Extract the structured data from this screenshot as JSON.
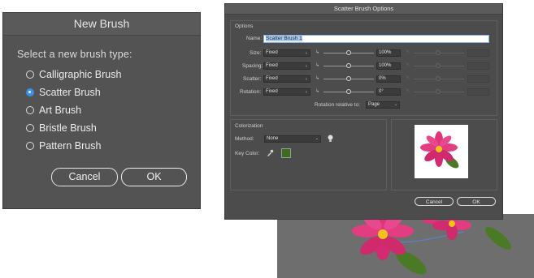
{
  "new_brush": {
    "title": "New Brush",
    "prompt": "Select a new brush type:",
    "options": [
      {
        "label": "Calligraphic Brush",
        "selected": false
      },
      {
        "label": "Scatter Brush",
        "selected": true
      },
      {
        "label": "Art Brush",
        "selected": false
      },
      {
        "label": "Bristle Brush",
        "selected": false
      },
      {
        "label": "Pattern Brush",
        "selected": false
      }
    ],
    "cancel_label": "Cancel",
    "ok_label": "OK"
  },
  "scatter": {
    "title": "Scatter Brush Options",
    "options_heading": "Options",
    "name_label": "Name:",
    "name_value": "Scatter Brush 1",
    "rows": [
      {
        "label": "Size:",
        "mode": "Fixed",
        "value": "100%"
      },
      {
        "label": "Spacing:",
        "mode": "Fixed",
        "value": "100%"
      },
      {
        "label": "Scatter:",
        "mode": "Fixed",
        "value": "0%"
      },
      {
        "label": "Rotation:",
        "mode": "Fixed",
        "value": "0°"
      }
    ],
    "rotation_relative_label": "Rotation relative to:",
    "rotation_relative_value": "Page",
    "colorization_heading": "Colorization",
    "method_label": "Method:",
    "method_value": "None",
    "key_color_label": "Key Color:",
    "key_color": "#3f6b1e",
    "cancel_label": "Cancel",
    "ok_label": "OK"
  },
  "colors": {
    "dialog_bg": "#535353",
    "accent_blue": "#3a8ee6",
    "flower_pink": "#e0337a",
    "flower_center": "#f2c21a",
    "leaf_green": "#4a7a26"
  },
  "icons": {
    "tip": "lightbulb-icon",
    "eyedropper": "eyedropper-icon"
  }
}
